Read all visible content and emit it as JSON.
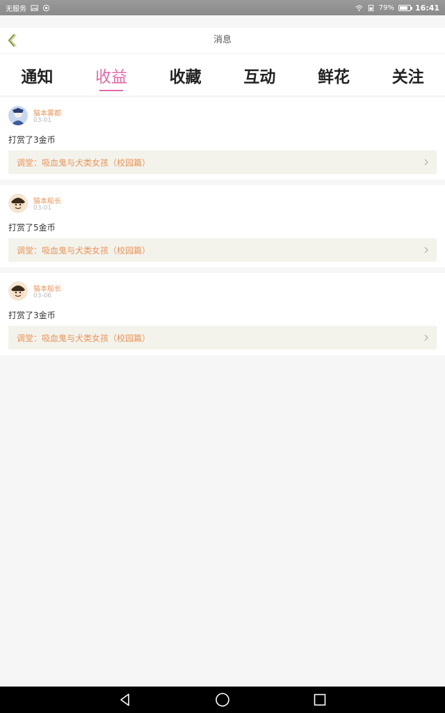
{
  "status_bar": {
    "carrier": "无服务",
    "battery": "79%",
    "battery_level": 0.79,
    "time": "16:41"
  },
  "header": {
    "title": "消息",
    "back_icon": "chevron-left-icon"
  },
  "tabs": [
    {
      "label": "通知",
      "active": false
    },
    {
      "label": "收益",
      "active": true
    },
    {
      "label": "收藏",
      "active": false
    },
    {
      "label": "互动",
      "active": false
    },
    {
      "label": "鲜花",
      "active": false
    },
    {
      "label": "关注",
      "active": false
    }
  ],
  "messages": [
    {
      "user": "猫本雾都",
      "date": "03-01",
      "text": "打赏了3金币",
      "ref": "调堂：吸血鬼与犬类女孩（校园篇）"
    },
    {
      "user": "猫本船长",
      "date": "03-01",
      "text": "打赏了5金币",
      "ref": "调堂：吸血鬼与犬类女孩（校园篇）"
    },
    {
      "user": "猫本船长",
      "date": "03-06",
      "text": "打赏了3金币",
      "ref": "调堂：吸血鬼与犬类女孩（校园篇）"
    }
  ],
  "nav_bar": {
    "back": "triangle-back-icon",
    "home": "circle-home-icon",
    "recents": "square-recents-icon"
  },
  "colors": {
    "accent": "#e06aa8",
    "orange_text": "#e8945a",
    "ref_bg": "#f3f3ec"
  }
}
